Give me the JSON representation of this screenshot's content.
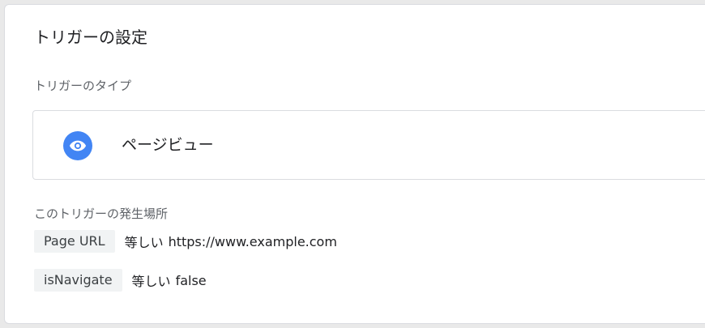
{
  "card": {
    "title": "トリガーの設定"
  },
  "trigger_type": {
    "label": "トリガーのタイプ",
    "name": "ページビュー",
    "icon": "eye-icon",
    "icon_color": "#4285f4"
  },
  "fires_on": {
    "label": "このトリガーの発生場所",
    "conditions": [
      {
        "variable": "Page URL",
        "operator": "等しい",
        "value": "https://www.example.com"
      },
      {
        "variable": "isNavigate",
        "operator": "等しい",
        "value": "false"
      }
    ]
  }
}
